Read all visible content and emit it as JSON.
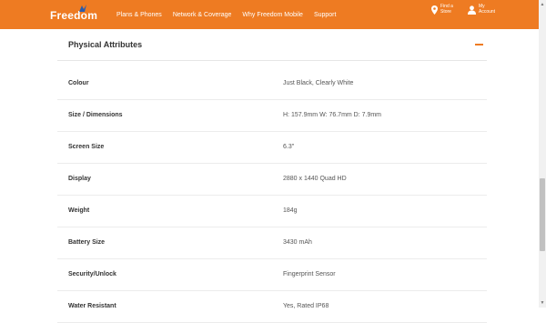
{
  "header": {
    "logo": "Freedom",
    "nav": [
      "Plans & Phones",
      "Network & Coverage",
      "Why Freedom Mobile",
      "Support"
    ],
    "find_store": [
      "Find a",
      "Store"
    ],
    "my_account": [
      "My",
      "Account"
    ],
    "accent_color": "#ee7b22"
  },
  "section": {
    "title": "Physical Attributes",
    "rows": [
      {
        "label": "Colour",
        "value": "Just Black, Clearly White"
      },
      {
        "label": "Size / Dimensions",
        "value": "H: 157.9mm W: 76.7mm D: 7.9mm"
      },
      {
        "label": "Screen Size",
        "value": "6.3\""
      },
      {
        "label": "Display",
        "value": "2880 x 1440 Quad HD"
      },
      {
        "label": "Weight",
        "value": "184g"
      },
      {
        "label": "Battery Size",
        "value": "3430 mAh"
      },
      {
        "label": "Security/Unlock",
        "value": "Fingerprint Sensor"
      },
      {
        "label": "Water Resistant",
        "value": "Yes, Rated IP68"
      }
    ]
  }
}
